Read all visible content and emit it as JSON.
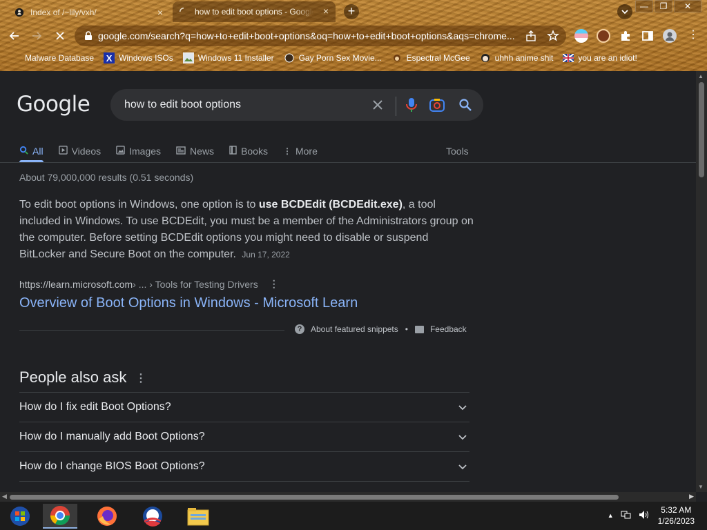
{
  "browser": {
    "tabs": [
      {
        "title": "Index of /~lily/vxh/",
        "close": "×"
      },
      {
        "title": "how to edit boot options - Google",
        "close": "×"
      }
    ],
    "new_tab": "+",
    "window_buttons": {
      "minimize": "—",
      "maximize": "❐",
      "close": "✕"
    },
    "url": "google.com/search?q=how+to+edit+boot+options&oq=how+to+edit+boot+options&aqs=chrome...",
    "bookmarks": [
      "Malware Database",
      "Windows ISOs",
      "Windows 11 Installer",
      "Gay Porn Sex Movie...",
      "Espectral McGee",
      "uhhh anime shit",
      "you are an idiot!"
    ]
  },
  "google": {
    "logo": "Google",
    "query": "how to edit boot options",
    "tabs": [
      "All",
      "Videos",
      "Images",
      "News",
      "Books",
      "More"
    ],
    "tools": "Tools",
    "stats": "About 79,000,000 results (0.51 seconds)",
    "snippet": {
      "pre": "To edit boot options in Windows, one option is to ",
      "bold": "use BCDEdit (BCDEdit.exe)",
      "post": ", a tool included in Windows. To use BCDEdit, you must be a member of the Administrators group on the computer. Before setting BCDEdit options you might need to disable or suspend BitLocker and Secure Boot on the computer.",
      "date": "Jun 17, 2022"
    },
    "cite": {
      "site": "https://learn.microsoft.com",
      "crumb": " › ... › Tools for Testing Drivers"
    },
    "result_title": "Overview of Boot Options in Windows - Microsoft Learn",
    "about_snippets": "About featured snippets",
    "bullet": "•",
    "feedback": "Feedback",
    "paa_title": "People also ask",
    "paa": [
      "How do I fix edit Boot Options?",
      "How do I manually add Boot Options?",
      "How do I change BIOS Boot Options?"
    ]
  },
  "taskbar": {
    "time": "5:32 AM",
    "date": "1/26/2023"
  },
  "colors": {
    "link": "#8ab4f8",
    "background": "#202124",
    "chrome_wood": "#b07a2c"
  }
}
